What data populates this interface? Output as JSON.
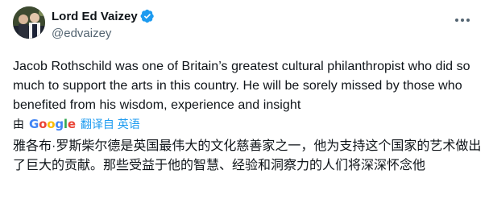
{
  "author": {
    "display_name": "Lord Ed Vaizey",
    "handle": "@edvaizey",
    "avatar": "user-avatar-photo",
    "verified_icon": "verified-badge-icon"
  },
  "menu": {
    "icon": "more-options-icon"
  },
  "post": {
    "text_original": "Jacob Rothschild was one of Britain’s greatest cultural philanthropist who did so much to support the arts in this country. He will be sorely missed by those who benefited from his wisdom, experience and insight",
    "translation_by_label": "由",
    "translation_provider": "Google",
    "translation_link_label": "翻译自 英语",
    "text_translated": "雅各布·罗斯柴尔德是英国最伟大的文化慈善家之一，他为支持这个国家的艺术做出了巨大的贡献。那些受益于他的智慧、经验和洞察力的人们将深深怀念他"
  },
  "colors": {
    "text_primary": "#0f1419",
    "text_secondary": "#536471",
    "link_blue": "#1d9bf0",
    "verified_blue": "#1d9bf0"
  }
}
